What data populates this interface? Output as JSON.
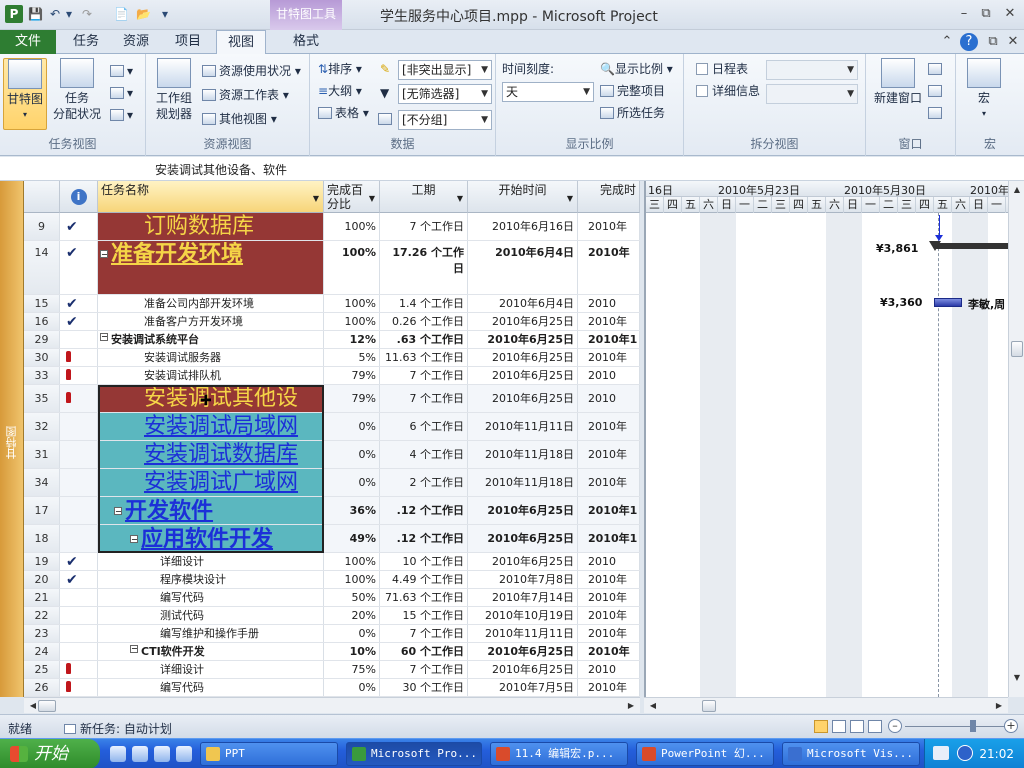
{
  "window": {
    "title": "学生服务中心项目.mpp - Microsoft Project",
    "context_tab": "甘特图工具"
  },
  "ribbon_tabs": [
    "任务",
    "资源",
    "项目",
    "视图",
    "格式"
  ],
  "file_tab": "文件",
  "active_tab": "视图",
  "ribbon": {
    "task_views": {
      "label": "任务视图",
      "gantt": "甘特图",
      "task_usage_line1": "任务",
      "task_usage_line2": "分配状况"
    },
    "resource_views": {
      "label": "资源视图",
      "team_planner_line1": "工作组",
      "team_planner_line2": "规划器",
      "resource_usage": "资源使用状况",
      "resource_sheet": "资源工作表",
      "other_views": "其他视图"
    },
    "data": {
      "label": "数据",
      "sort": "排序",
      "outline": "大纲",
      "tables": "表格",
      "highlight_value": "[非突出显示]",
      "filter_value": "[无筛选器]",
      "group_value": "[不分组]"
    },
    "zoom": {
      "label": "显示比例",
      "timescale_label": "时间刻度:",
      "timescale_value": "天",
      "zoom_btn": "显示比例",
      "entire_project": "完整项目",
      "selected_tasks": "所选任务"
    },
    "split": {
      "label": "拆分视图",
      "timeline": "日程表",
      "details": "详细信息"
    },
    "window": {
      "label": "窗口",
      "new_window": "新建窗口"
    },
    "macros": {
      "label": "宏",
      "macro": "宏"
    }
  },
  "timeline_text": "安装调试其他设备、软件",
  "viewbar_label": "甘特图",
  "table": {
    "headers": {
      "name": "任务名称",
      "pct_line1": "完成百",
      "pct_line2": "分比",
      "duration": "工期",
      "start": "开始时间",
      "finish": "完成时"
    },
    "rows": [
      {
        "id": "9",
        "ind": "check",
        "name": "订购数据库",
        "pct": "100%",
        "dur": "7 个工作日",
        "start": "2010年6月16日",
        "fin": "2010年"
      },
      {
        "id": "14",
        "ind": "check",
        "name": "准备开发环境",
        "pct": "100%",
        "dur_line1": "17.26 个工作",
        "dur_line2": "日",
        "start": "2010年6月4日",
        "fin": "2010年"
      },
      {
        "id": "15",
        "ind": "check",
        "name": "准备公司内部开发环境",
        "pct": "100%",
        "dur": "1.4 个工作日",
        "start": "2010年6月4日",
        "fin": "2010"
      },
      {
        "id": "16",
        "ind": "check",
        "name": "准备客户方开发环境",
        "pct": "100%",
        "dur": "0.26 个工作日",
        "start": "2010年6月25日",
        "fin": "2010年"
      },
      {
        "id": "29",
        "ind": "",
        "name": "安装调试系统平台",
        "pct": "12%",
        "dur": ".63 个工作日",
        "start": "2010年6月25日",
        "fin": "2010年1"
      },
      {
        "id": "30",
        "ind": "person",
        "name": "安装调试服务器",
        "pct": "5%",
        "dur": "11.63 个工作日",
        "start": "2010年6月25日",
        "fin": "2010年"
      },
      {
        "id": "33",
        "ind": "person",
        "name": "安装调试排队机",
        "pct": "79%",
        "dur": "7 个工作日",
        "start": "2010年6月25日",
        "fin": "2010"
      },
      {
        "id": "35",
        "ind": "person",
        "name": "安装调试其他设",
        "pct": "79%",
        "dur": "7 个工作日",
        "start": "2010年6月25日",
        "fin": "2010"
      },
      {
        "id": "32",
        "ind": "",
        "name": "安装调试局域网",
        "pct": "0%",
        "dur": "6 个工作日",
        "start": "2010年11月11日",
        "fin": "2010年"
      },
      {
        "id": "31",
        "ind": "",
        "name": "安装调试数据库",
        "pct": "0%",
        "dur": "4 个工作日",
        "start": "2010年11月18日",
        "fin": "2010年"
      },
      {
        "id": "34",
        "ind": "",
        "name": "安装调试广域网",
        "pct": "0%",
        "dur": "2 个工作日",
        "start": "2010年11月18日",
        "fin": "2010年"
      },
      {
        "id": "17",
        "ind": "",
        "name": "开发软件",
        "pct": "36%",
        "dur": "\u0002.12 个工作日",
        "start": "2010年6月25日",
        "fin": "2010年1"
      },
      {
        "id": "18",
        "ind": "",
        "name": "应用软件开发",
        "pct": "49%",
        "dur": "\u0002.12 个工作日",
        "start": "2010年6月25日",
        "fin": "2010年1"
      },
      {
        "id": "19",
        "ind": "check",
        "name": "详细设计",
        "pct": "100%",
        "dur": "10 个工作日",
        "start": "2010年6月25日",
        "fin": "2010"
      },
      {
        "id": "20",
        "ind": "check",
        "name": "程序模块设计",
        "pct": "100%",
        "dur": "4.49 个工作日",
        "start": "2010年7月8日",
        "fin": "2010年"
      },
      {
        "id": "21",
        "ind": "",
        "name": "编写代码",
        "pct": "50%",
        "dur": "71.63 个工作日",
        "start": "2010年7月14日",
        "fin": "2010年"
      },
      {
        "id": "22",
        "ind": "",
        "name": "测试代码",
        "pct": "20%",
        "dur": "15 个工作日",
        "start": "2010年10月19日",
        "fin": "2010年"
      },
      {
        "id": "23",
        "ind": "",
        "name": "编写维护和操作手册",
        "pct": "0%",
        "dur": "7 个工作日",
        "start": "2010年11月11日",
        "fin": "2010年"
      },
      {
        "id": "24",
        "ind": "",
        "name": "CTI软件开发",
        "pct": "10%",
        "dur": "60 个工作日",
        "start": "2010年6月25日",
        "fin": "2010年"
      },
      {
        "id": "25",
        "ind": "person",
        "name": "详细设计",
        "pct": "75%",
        "dur": "7 个工作日",
        "start": "2010年6月25日",
        "fin": "2010"
      },
      {
        "id": "26",
        "ind": "person",
        "name": "编写代码",
        "pct": "0%",
        "dur": "30 个工作日",
        "start": "2010年7月5日",
        "fin": "2010年"
      }
    ]
  },
  "gantt": {
    "top_labels": [
      "16日",
      "2010年5月23日",
      "2010年5月30日",
      "2010年"
    ],
    "days": [
      "三",
      "四",
      "五",
      "六",
      "日",
      "一",
      "二",
      "三",
      "四",
      "五",
      "六",
      "日",
      "一",
      "二",
      "三",
      "四",
      "五",
      "六",
      "日",
      "一"
    ],
    "cost_summary": "¥3,861",
    "cost_task": "¥3,360",
    "resource_names": "李敏,周"
  },
  "status": {
    "ready": "就绪",
    "new_tasks": "新任务: 自动计划"
  },
  "taskbar": {
    "start": "开始",
    "buttons": [
      "PPT",
      "Microsoft Pro...",
      "11.4 编辑宏.p...",
      "PowerPoint 幻...",
      "Microsoft Vis..."
    ],
    "clock": "21:02"
  },
  "colors": {
    "file_tab": "#2e7d32",
    "summary_red": "#953735",
    "summary_text_yellow": "#f5d547",
    "selected_teal": "#5bb7bf",
    "link_blue": "#1c2fd8",
    "viewbar_orange": "#e6ad52"
  }
}
